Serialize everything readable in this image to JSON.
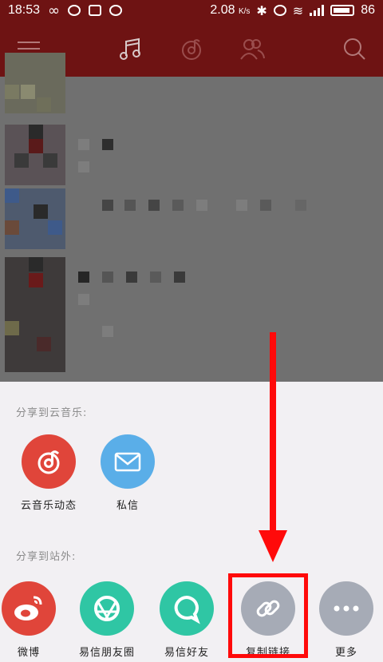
{
  "status_bar": {
    "time": "18:53",
    "network_speed": "2.08",
    "network_unit": "K/s",
    "battery": "86"
  },
  "header": {
    "icons": [
      "menu-icon",
      "music-icon",
      "netease-icon",
      "friends-icon",
      "search-icon"
    ]
  },
  "share_sheet": {
    "section_internal": "分享到云音乐:",
    "section_external": "分享到站外:",
    "internal_items": [
      {
        "label": "云音乐动态",
        "color": "#e0453a",
        "icon": "netease-icon"
      },
      {
        "label": "私信",
        "color": "#5aaee8",
        "icon": "mail-icon"
      }
    ],
    "external_items": [
      {
        "label": "微博",
        "color": "#e0453a",
        "icon": "weibo-icon"
      },
      {
        "label": "易信朋友圈",
        "color": "#2fc6a4",
        "icon": "yixin-moments-icon"
      },
      {
        "label": "易信好友",
        "color": "#2fc6a4",
        "icon": "yixin-chat-icon"
      },
      {
        "label": "复制链接",
        "color": "#a6abb6",
        "icon": "link-icon"
      },
      {
        "label": "更多",
        "color": "#a6abb6",
        "icon": "more-icon"
      }
    ]
  },
  "colors": {
    "header_bg": "#6e1313",
    "sheet_bg": "#f2f0f3",
    "annotation": "#ff0a0a"
  }
}
